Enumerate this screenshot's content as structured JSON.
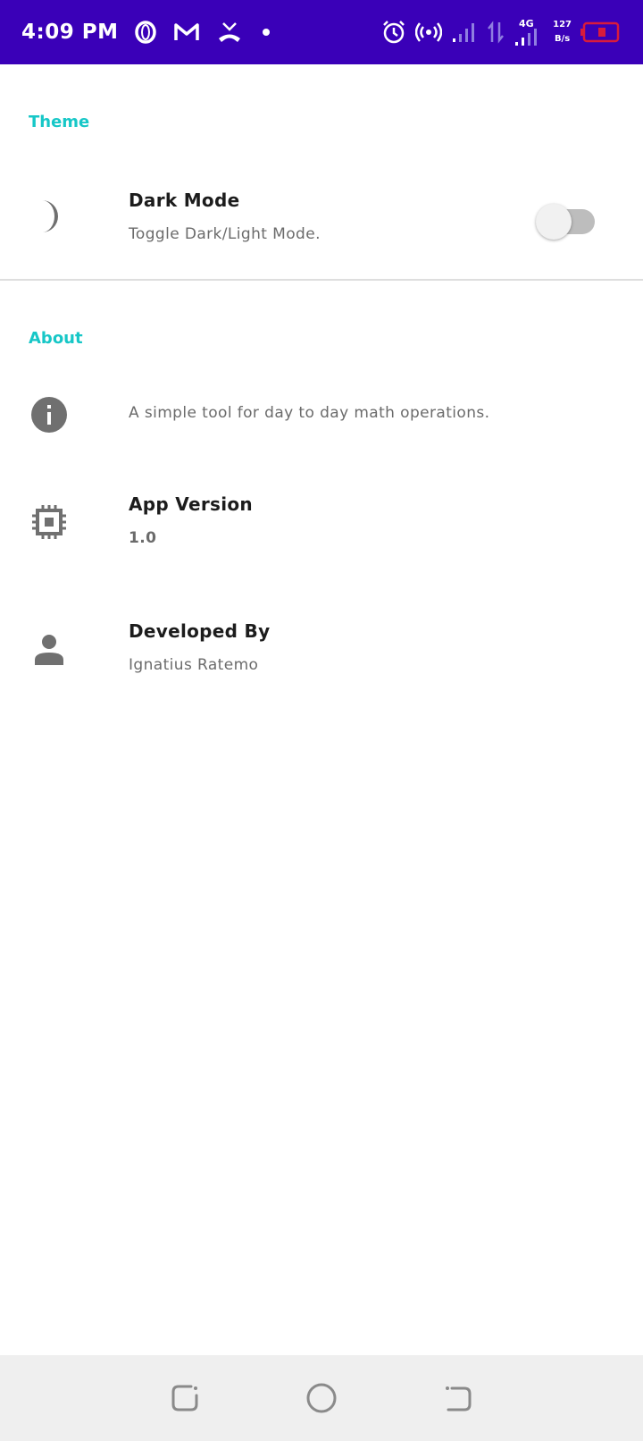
{
  "status_bar": {
    "time": "4:09 PM",
    "network_type": "4G",
    "speed_value": "127",
    "speed_unit": "B/s",
    "background_color": "#3a00b8",
    "icons": [
      "opera-icon",
      "gmail-icon",
      "missed-call-icon",
      "notification-dot-icon",
      "alarm-icon",
      "hotspot-icon",
      "signal-icon",
      "data-arrows-icon",
      "signal-4g-icon",
      "battery-low-icon"
    ]
  },
  "sections": {
    "theme": {
      "header": "Theme",
      "dark_mode": {
        "title": "Dark Mode",
        "summary": "Toggle Dark/Light Mode.",
        "enabled": false,
        "icon": "moon-icon"
      }
    },
    "about": {
      "header": "About",
      "description": {
        "summary": "A simple tool for day to day math operations.",
        "icon": "info-icon"
      },
      "app_version": {
        "title": "App Version",
        "summary": "1.0",
        "icon": "chip-icon"
      },
      "developer": {
        "title": "Developed By",
        "summary": "Ignatius Ratemo",
        "icon": "person-icon"
      }
    }
  },
  "nav_bar": {
    "buttons": [
      "recents-button",
      "home-button",
      "back-button"
    ]
  },
  "colors": {
    "accent": "#17c7c7",
    "icon": "#707070",
    "title_text": "#1c1c1c",
    "summary_text": "#6b6b6b"
  }
}
